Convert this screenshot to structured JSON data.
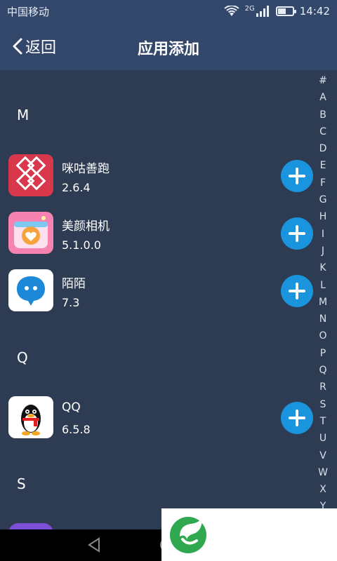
{
  "status_bar": {
    "carrier": "中国移动",
    "network": "2G",
    "time": "14:42",
    "battery_level": 0.55
  },
  "header": {
    "back_label": "返回",
    "title": "应用添加"
  },
  "sections": [
    {
      "letter": "M",
      "apps": [
        {
          "name": "咪咕善跑",
          "version": "2.6.4",
          "icon": "migu-run-icon"
        },
        {
          "name": "美颜相机",
          "version": "5.1.0.0",
          "icon": "beauty-camera-icon"
        },
        {
          "name": "陌陌",
          "version": "7.3",
          "icon": "momo-icon"
        }
      ]
    },
    {
      "letter": "Q",
      "apps": [
        {
          "name": "QQ",
          "version": "6.5.8",
          "icon": "qq-penguin-icon"
        }
      ]
    },
    {
      "letter": "S",
      "apps": []
    }
  ],
  "alphabet_index": [
    "#",
    "A",
    "B",
    "C",
    "D",
    "E",
    "F",
    "G",
    "H",
    "I",
    "J",
    "K",
    "L",
    "M",
    "N",
    "O",
    "P",
    "Q",
    "R",
    "S",
    "T",
    "U",
    "V",
    "W",
    "X",
    "Y"
  ],
  "colors": {
    "background": "#2d3c52",
    "header": "#33476a",
    "accent": "#1a94dc"
  }
}
